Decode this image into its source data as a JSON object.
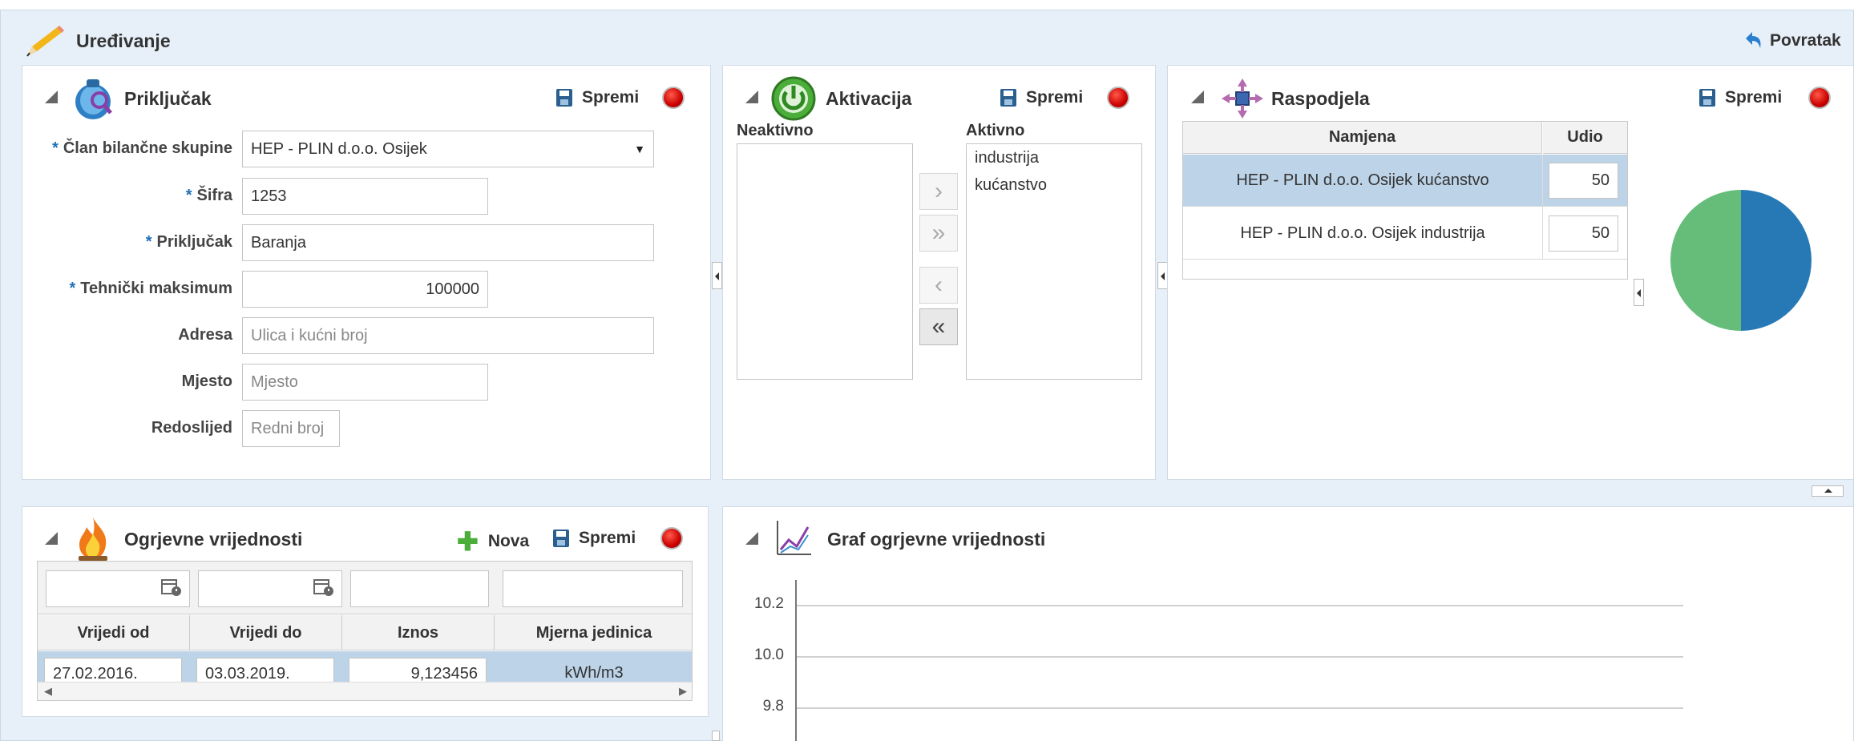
{
  "header": {
    "title": "Uređivanje",
    "back_label": "Povratak"
  },
  "prikljucak": {
    "title": "Priključak",
    "save_label": "Spremi",
    "fields": {
      "clan": {
        "label": "Član bilančne skupine",
        "value": "HEP - PLIN d.o.o. Osijek"
      },
      "sifra": {
        "label": "Šifra",
        "value": "1253"
      },
      "prikljucak": {
        "label": "Priključak",
        "value": "Baranja"
      },
      "tehnicki": {
        "label": "Tehnički maksimum",
        "value": "100000"
      },
      "adresa": {
        "label": "Adresa",
        "placeholder": "Ulica i kućni broj"
      },
      "mjesto": {
        "label": "Mjesto",
        "placeholder": "Mjesto"
      },
      "redoslijed": {
        "label": "Redoslijed",
        "placeholder": "Redni broj"
      }
    },
    "required_mark": "*"
  },
  "aktivacija": {
    "title": "Aktivacija",
    "save_label": "Spremi",
    "inactive_label": "Neaktivno",
    "active_label": "Aktivno",
    "active_items": [
      "industrija",
      "kućanstvo"
    ],
    "move_buttons": [
      "›",
      "»",
      "‹",
      "«"
    ]
  },
  "raspodjela": {
    "title": "Raspodjela",
    "save_label": "Spremi",
    "columns": [
      "Namjena",
      "Udio"
    ],
    "rows": [
      {
        "namjena": "HEP - PLIN d.o.o. Osijek kućanstvo",
        "udio": "50",
        "selected": true
      },
      {
        "namjena": "HEP - PLIN d.o.o. Osijek industrija",
        "udio": "50",
        "selected": false
      }
    ],
    "pie_colors": [
      "#2679b5",
      "#66bd7a"
    ],
    "pie_values": [
      50,
      50
    ]
  },
  "ogrjevne": {
    "title": "Ogrjevne vrijednosti",
    "new_label": "Nova",
    "save_label": "Spremi",
    "columns": [
      "Vrijedi od",
      "Vrijedi do",
      "Iznos",
      "Mjerna jedinica"
    ],
    "rows": [
      {
        "od": "27.02.2016.",
        "do": "03.03.2019.",
        "iznos": "9,123456",
        "jedinica": "kWh/m3"
      }
    ]
  },
  "graf": {
    "title": "Graf ogrjevne vrijednosti",
    "chart_data": {
      "type": "line",
      "y_ticks": [
        "10.2",
        "10.0",
        "9.8"
      ],
      "grid": true
    }
  },
  "colors": {
    "accent": "#1f6fb8",
    "page_bg": "#e7f0f8",
    "selected_row": "#bcd3e8"
  }
}
